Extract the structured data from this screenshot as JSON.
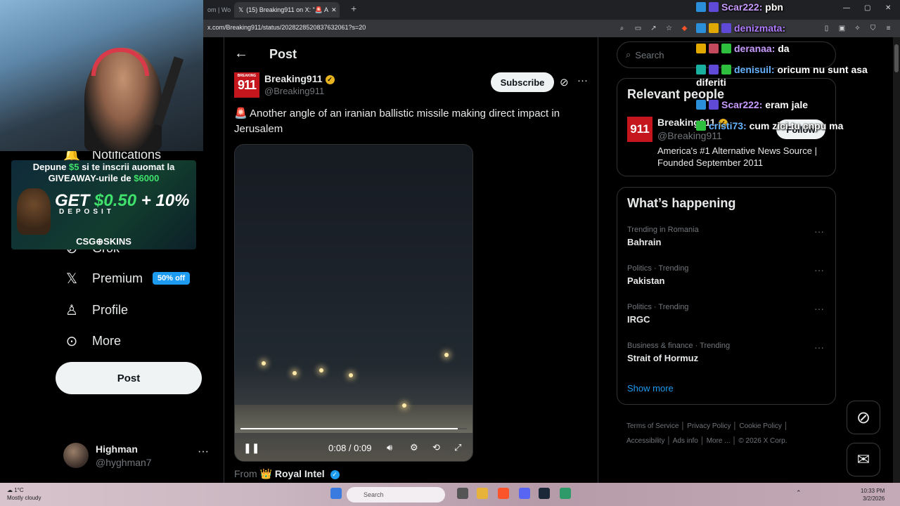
{
  "browser": {
    "tab1_label": "om | Wo",
    "tab2_label": "(15) Breaking911 on X: \"🚨 A",
    "url": "x.com/Breaking911/status/2028228520837632061?s=20"
  },
  "left_nav": {
    "notifications_label": "Notifications",
    "grok_label": "Grok",
    "premium_label": "Premium",
    "premium_badge": "50% off",
    "profile_label": "Profile",
    "more_label": "More",
    "post_button": "Post",
    "account_name": "Highman",
    "account_handle": "@hyghman7"
  },
  "post": {
    "header_title": "Post",
    "author_name": "Breaking911",
    "author_handle": "@Breaking911",
    "logo_text": "911",
    "logo_small": "BREAKING",
    "subscribe_label": "Subscribe",
    "text": "🚨 Another angle of an iranian ballistic missile making direct impact in Jerusalem",
    "video_time": "0:08 / 0:09",
    "video_progress": 0.96,
    "from_prefix": "From",
    "from_name": "👑 Royal Intel"
  },
  "sidebar": {
    "search_placeholder": "Search",
    "relevant_title": "Relevant people",
    "rel_name": "Breaking911",
    "rel_handle": "@Breaking911",
    "rel_bio": "America's #1 Alternative News Source | Founded September 2011",
    "follow_label": "Follow",
    "happening_title": "What’s happening",
    "trends": [
      {
        "meta": "Trending in Romania",
        "name": "Bahrain"
      },
      {
        "meta": "Politics · Trending",
        "name": "Pakistan"
      },
      {
        "meta": "Politics · Trending",
        "name": "IRGC"
      },
      {
        "meta": "Business & finance · Trending",
        "name": "Strait of Hormuz"
      }
    ],
    "show_more": "Show more",
    "footer": [
      "Terms of Service",
      "Privacy Policy",
      "Cookie Policy",
      "Accessibility",
      "Ads info",
      "More ...",
      "© 2026 X Corp."
    ]
  },
  "overlay": {
    "ad_line1_a": "Depune ",
    "ad_line1_b": "$5",
    "ad_line1_c": " si te inscrii auomat la",
    "ad_line2_a": "GIVEAWAY-urile de ",
    "ad_line2_b": "$6000",
    "ad_big_a": "GET ",
    "ad_big_b": "$0.50",
    "ad_big_c": " + 10%",
    "ad_deposit": "DEPOSIT",
    "ad_logo": "CSG⊕SKINS"
  },
  "chat": [
    {
      "user": "Scar222:",
      "msg": "pbn",
      "color": "#c89bff"
    },
    {
      "user": "denizmata:",
      "msg": "",
      "color": "#b07cff"
    },
    {
      "user": "deranaa:",
      "msg": "da",
      "color": "#c89bff"
    },
    {
      "user": "denisuil:",
      "msg": "oricum nu sunt asa diferiti",
      "color": "#66b3ff"
    },
    {
      "user": "Scar222:",
      "msg": "eram jale",
      "color": "#c89bff"
    },
    {
      "user": "cristi73:",
      "msg": "cum zici tu cnpu ma",
      "color": "#66b3ff"
    }
  ],
  "taskbar": {
    "temp": "1°C",
    "weather": "Mostly cloudy",
    "search": "Search",
    "time": "10:33 PM",
    "date": "3/2/2026"
  }
}
